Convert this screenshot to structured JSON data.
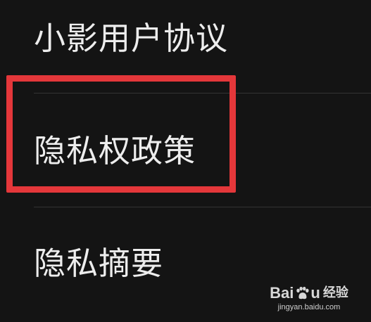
{
  "settings_list": {
    "items": [
      {
        "label": "小影用户协议"
      },
      {
        "label": "隐私权政策"
      },
      {
        "label": "隐私摘要"
      }
    ]
  },
  "highlight": {
    "color": "#e4373a",
    "target": "隐私权政策"
  },
  "watermark": {
    "brand_left": "Bai",
    "brand_right": "u",
    "brand_cn": "经验",
    "url": "jingyan.baidu.com"
  }
}
